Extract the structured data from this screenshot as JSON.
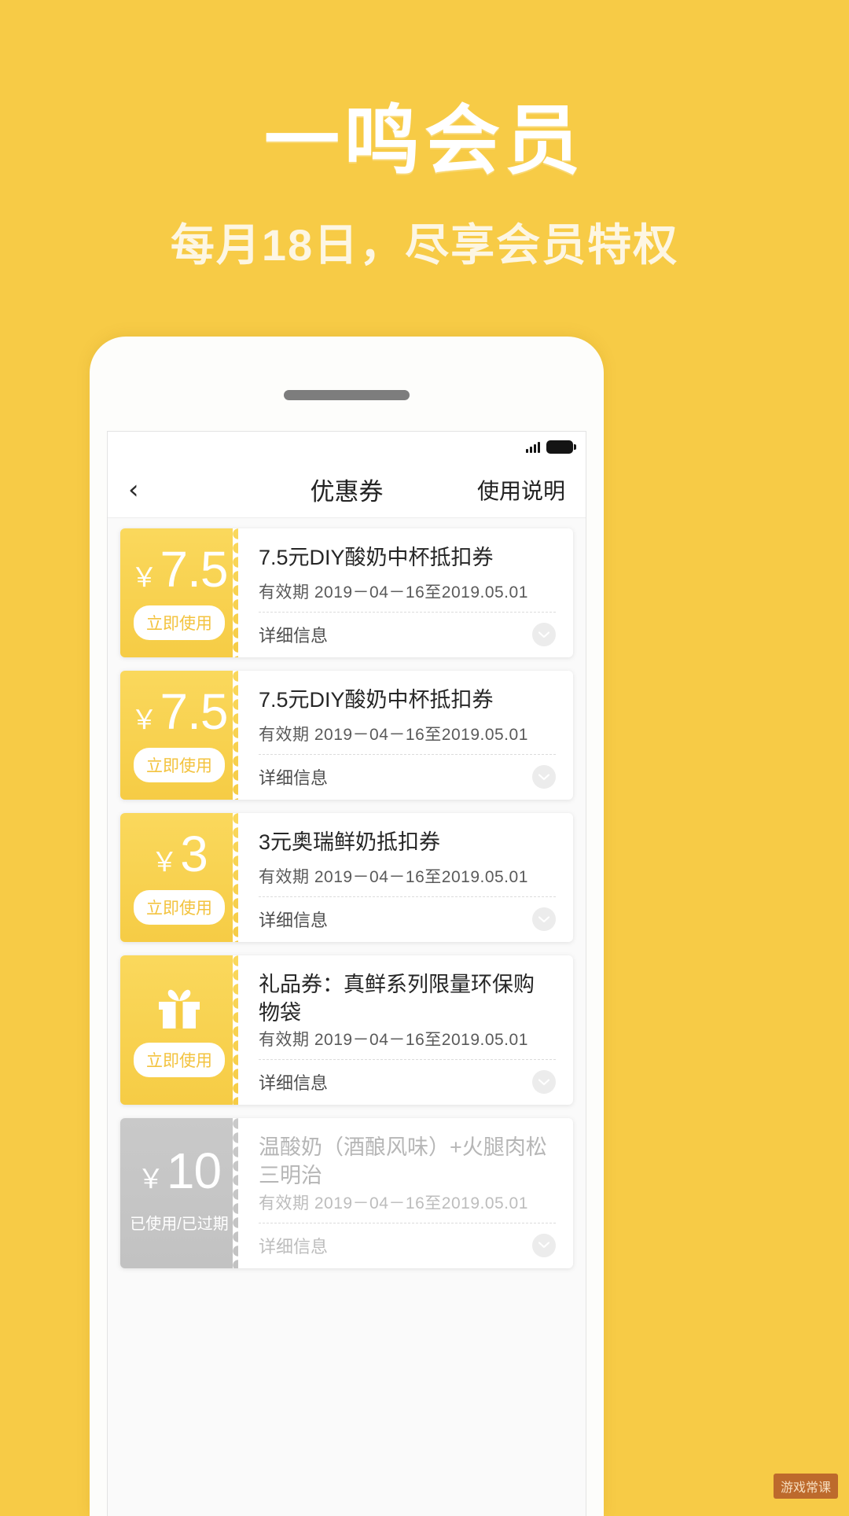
{
  "promo": {
    "title": "一鸣会员",
    "subtitle": "每月18日，尽享会员特权",
    "bg_color": "#f7cb46",
    "title_color": "#ffffff",
    "subtitle_color": "#fdf6e3"
  },
  "statusbar": {
    "signal_icon": "signal-bars-icon",
    "battery_icon": "battery-full-icon"
  },
  "navbar": {
    "back_label": "‹",
    "title": "优惠券",
    "action_label": "使用说明"
  },
  "coupons": [
    {
      "currency": "￥",
      "amount": "7.5",
      "action_label": "立即使用",
      "title": "7.5元DIY酸奶中杯抵扣券",
      "validity_label": "有效期",
      "validity_value": "2019－04－16至2019.05.01",
      "detail_label": "详细信息",
      "state": "active",
      "icon": ""
    },
    {
      "currency": "￥",
      "amount": "7.5",
      "action_label": "立即使用",
      "title": "7.5元DIY酸奶中杯抵扣券",
      "validity_label": "有效期",
      "validity_value": "2019－04－16至2019.05.01",
      "detail_label": "详细信息",
      "state": "active",
      "icon": ""
    },
    {
      "currency": "￥",
      "amount": "3",
      "action_label": "立即使用",
      "title": "3元奥瑞鲜奶抵扣券",
      "validity_label": "有效期",
      "validity_value": "2019－04－16至2019.05.01",
      "detail_label": "详细信息",
      "state": "active",
      "icon": ""
    },
    {
      "currency": "",
      "amount": "",
      "action_label": "立即使用",
      "title": "礼品券：真鲜系列限量环保购物袋",
      "validity_label": "有效期",
      "validity_value": "2019－04－16至2019.05.01",
      "detail_label": "详细信息",
      "state": "active",
      "icon": "gift-icon"
    },
    {
      "currency": "￥",
      "amount": "10",
      "action_label": "已使用/已过期",
      "title": "温酸奶（酒酿风味）+火腿肉松三明治",
      "validity_label": "有效期",
      "validity_value": "2019－04－16至2019.05.01",
      "detail_label": "详细信息",
      "state": "used",
      "icon": ""
    }
  ],
  "watermark": {
    "text": "游戏常课"
  }
}
